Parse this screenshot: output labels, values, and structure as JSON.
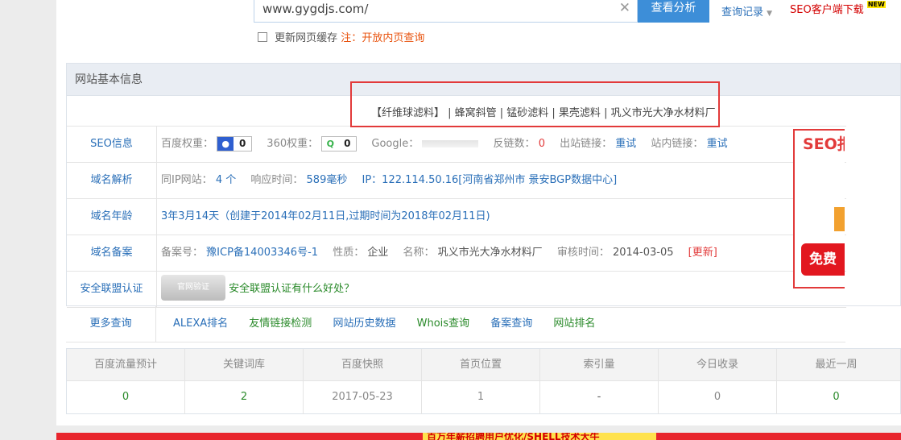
{
  "search": {
    "url": "www.gygdjs.com/",
    "clear_icon": "close-icon",
    "analyze_button": "查看分析",
    "history_link": "查询记录",
    "client_download": "SEO客户端下载",
    "new_badge": "NEW",
    "refresh_label": "更新网页缓存",
    "note_prefix": "注：",
    "note_text": "开放内页查询"
  },
  "site_info": {
    "title": "网站基本信息",
    "keywords": "【纤维球滤料】 | 蜂窝斜管 | 锰砂滤料 | 果壳滤料 | 巩义市光大净水材料厂"
  },
  "seo_row": {
    "label": "SEO信息",
    "baidu_label": "百度权重：",
    "baidu_value": "0",
    "q360_label": "360权重：",
    "q360_value": "0",
    "google_label": "Google：",
    "backlinks_label": "反链数：",
    "backlinks_value": "0",
    "outlinks_label": "出站链接：",
    "outlinks_retry": "重试",
    "inlinks_label": "站内链接：",
    "inlinks_retry": "重试"
  },
  "dns_row": {
    "label": "域名解析",
    "same_ip_label": "同IP网站：",
    "same_ip_value": "4 个",
    "response_label": "响应时间：",
    "response_value": "589毫秒",
    "ip_text": "IP：122.114.50.16[河南省郑州市 景安BGP数据中心]"
  },
  "age_row": {
    "label": "域名年龄",
    "value": "3年3月14天（创建于2014年02月11日,过期时间为2018年02月11日)"
  },
  "icp_row": {
    "label": "域名备案",
    "no_label": "备案号：",
    "no_value": "豫ICP备14003346号-1",
    "nature_label": "性质：",
    "nature_value": "企业",
    "name_label": "名称：",
    "name_value": "巩义市光大净水材料厂",
    "audit_label": "审核时间：",
    "audit_value": "2014-03-05",
    "update_link": "[更新]"
  },
  "security_row": {
    "label": "安全联盟认证",
    "seal_text": "官网验证",
    "link": "安全联盟认证有什么好处？"
  },
  "more_row": {
    "label": "更多查询",
    "links": [
      "ALEXA排名",
      "友情链接检测",
      "网站历史数据",
      "Whois查询",
      "备案查询",
      "网站排名"
    ]
  },
  "stats": {
    "headers": [
      "百度流量预计",
      "关键词库",
      "百度快照",
      "首页位置",
      "索引量",
      "今日收录",
      "最近一周"
    ],
    "values": [
      "0",
      "2",
      "2017-05-23",
      "1",
      "-",
      "0",
      "0"
    ]
  },
  "right_ad": {
    "title": "SEO报",
    "cta": "免费"
  },
  "bottom_ad": {
    "text": "百万年薪招聘用户优化/SHELL技术大牛"
  },
  "colors": {
    "link": "#2a6fb8",
    "green": "#2a8a2a",
    "red": "#e23a3a",
    "button": "#3d8ed8"
  }
}
